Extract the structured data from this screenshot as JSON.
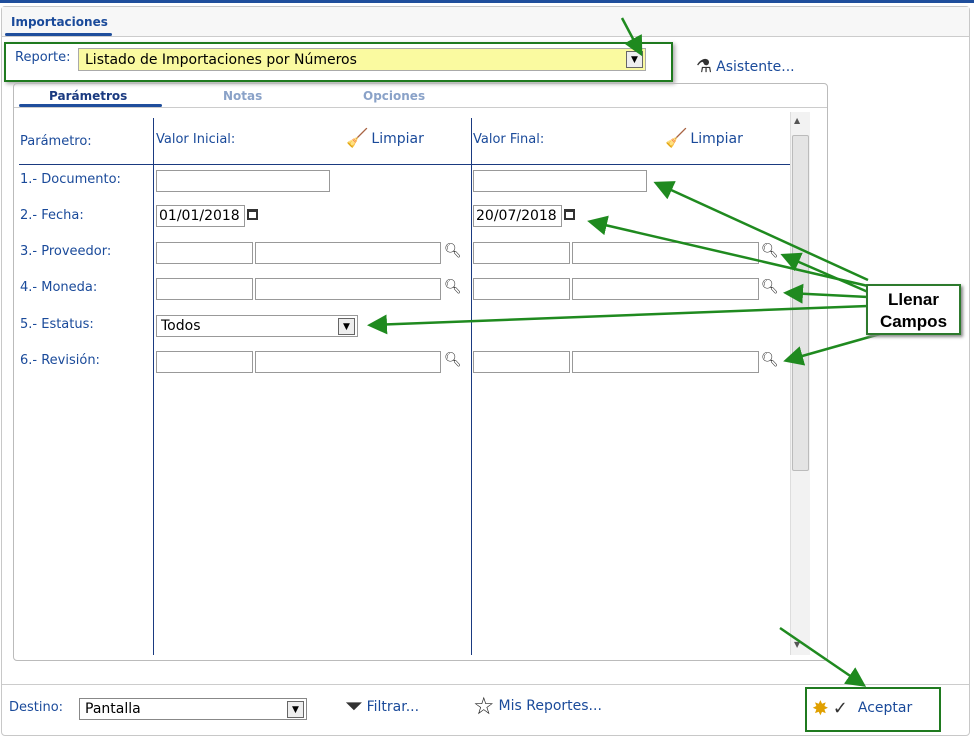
{
  "tab": "Importaciones",
  "reporte": {
    "label": "Reporte:",
    "value": "Listado de Importaciones por Números"
  },
  "asistente": "Asistente...",
  "inner_tabs": [
    "Parámetros",
    "Notas",
    "Opciones"
  ],
  "headers": {
    "param": "Parámetro:",
    "inicial": "Valor Inicial:",
    "final": "Valor Final:",
    "limpiar": "Limpiar"
  },
  "params": [
    "1.- Documento:",
    "2.- Fecha:",
    "3.- Proveedor:",
    "4.- Moneda:",
    "5.- Estatus:",
    "6.- Revisión:"
  ],
  "fecha_inicial": "01/01/2018",
  "fecha_final": "20/07/2018",
  "estatus": "Todos",
  "destino": {
    "label": "Destino:",
    "value": "Pantalla"
  },
  "filtrar": "Filtrar...",
  "mis_reportes": "Mis Reportes...",
  "aceptar": "Aceptar",
  "callout": {
    "line1": "Llenar",
    "line2": "Campos"
  },
  "colors": {
    "accent": "#1f4e9c",
    "highlight": "#1f7a1f",
    "select_bg": "#fafaa0"
  }
}
